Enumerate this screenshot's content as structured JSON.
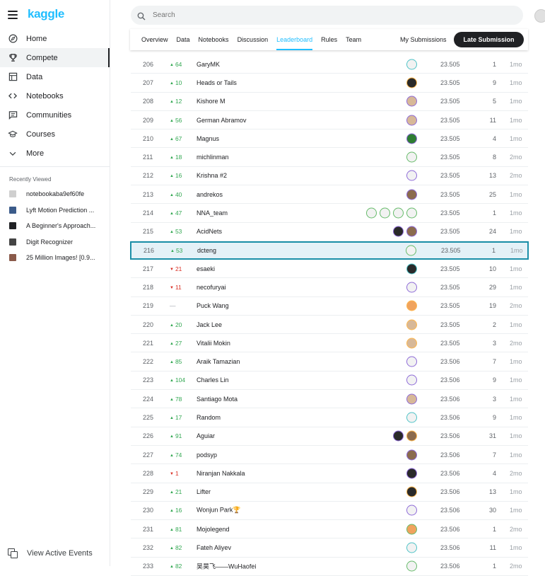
{
  "app": {
    "logo": "kaggle"
  },
  "sidebar": {
    "items": [
      {
        "label": "Home",
        "icon": "compass-icon",
        "active": false
      },
      {
        "label": "Compete",
        "icon": "trophy-icon",
        "active": true
      },
      {
        "label": "Data",
        "icon": "table-icon",
        "active": false
      },
      {
        "label": "Notebooks",
        "icon": "code-icon",
        "active": false
      },
      {
        "label": "Communities",
        "icon": "chat-icon",
        "active": false
      },
      {
        "label": "Courses",
        "icon": "mortarboard-icon",
        "active": false
      },
      {
        "label": "More",
        "icon": "chevron-down-icon",
        "active": false
      }
    ],
    "recent_title": "Recently Viewed",
    "recent": [
      {
        "label": "notebookaba9ef60fe",
        "color": "#cfcfcf"
      },
      {
        "label": "Lyft Motion Prediction ...",
        "color": "#3b5b8a"
      },
      {
        "label": "A Beginner's Approach...",
        "color": "#202124"
      },
      {
        "label": "Digit Recognizer",
        "color": "#444444"
      },
      {
        "label": "25 Million Images! [0.9...",
        "color": "#8a5a4a"
      }
    ],
    "active_events": "View Active Events"
  },
  "search": {
    "placeholder": "Search"
  },
  "tabs": [
    "Overview",
    "Data",
    "Notebooks",
    "Discussion",
    "Leaderboard",
    "Rules",
    "Team"
  ],
  "active_tab": "Leaderboard",
  "my_submissions": "My Submissions",
  "late_submission": "Late Submission",
  "colors": {
    "accent": "#20beff",
    "up": "#34a853",
    "down": "#d93025",
    "highlight_border": "#1b8fa8"
  },
  "leaderboard": [
    {
      "rank": "206",
      "delta": "64",
      "dir": "up",
      "team": "GaryMK",
      "score": "23.505",
      "entries": "1",
      "last": "1mo",
      "members": [
        [
          "white",
          "ring-teal"
        ]
      ]
    },
    {
      "rank": "207",
      "delta": "10",
      "dir": "up",
      "team": "Heads or Tails",
      "score": "23.505",
      "entries": "9",
      "last": "1mo",
      "members": [
        [
          "dark",
          "ring-orange"
        ]
      ]
    },
    {
      "rank": "208",
      "delta": "12",
      "dir": "up",
      "team": "Kishore M",
      "score": "23.505",
      "entries": "5",
      "last": "1mo",
      "members": [
        [
          "face",
          "ring-purple"
        ]
      ]
    },
    {
      "rank": "209",
      "delta": "56",
      "dir": "up",
      "team": "German Abramov",
      "score": "23.505",
      "entries": "11",
      "last": "1mo",
      "members": [
        [
          "face",
          "ring-purple"
        ]
      ]
    },
    {
      "rank": "210",
      "delta": "67",
      "dir": "up",
      "team": "Magnus",
      "score": "23.505",
      "entries": "4",
      "last": "1mo",
      "members": [
        [
          "green",
          "ring-purple"
        ]
      ]
    },
    {
      "rank": "211",
      "delta": "18",
      "dir": "up",
      "team": "michlinman",
      "score": "23.505",
      "entries": "8",
      "last": "2mo",
      "members": [
        [
          "white",
          "ring-green"
        ]
      ]
    },
    {
      "rank": "212",
      "delta": "16",
      "dir": "up",
      "team": "Krishna #2",
      "score": "23.505",
      "entries": "13",
      "last": "2mo",
      "members": [
        [
          "white",
          "ring-purple"
        ]
      ]
    },
    {
      "rank": "213",
      "delta": "40",
      "dir": "up",
      "team": "andrekos",
      "score": "23.505",
      "entries": "25",
      "last": "1mo",
      "members": [
        [
          "brown",
          "ring-purple"
        ]
      ]
    },
    {
      "rank": "214",
      "delta": "47",
      "dir": "up",
      "team": "NNA_team",
      "score": "23.505",
      "entries": "1",
      "last": "1mo",
      "members": [
        [
          "white",
          "ring-green"
        ],
        [
          "white",
          "ring-green"
        ],
        [
          "white",
          "ring-green"
        ],
        [
          "white",
          "ring-green"
        ]
      ]
    },
    {
      "rank": "215",
      "delta": "53",
      "dir": "up",
      "team": "AcidNets",
      "score": "23.505",
      "entries": "24",
      "last": "1mo",
      "members": [
        [
          "dark",
          "ring-purple"
        ],
        [
          "brown",
          "ring-purple"
        ]
      ]
    },
    {
      "rank": "216",
      "delta": "53",
      "dir": "up",
      "team": "dcteng",
      "score": "23.505",
      "entries": "1",
      "last": "1mo",
      "members": [
        [
          "white",
          "ring-green"
        ]
      ],
      "highlight": true
    },
    {
      "rank": "217",
      "delta": "21",
      "dir": "down",
      "team": "esaeki",
      "score": "23.505",
      "entries": "10",
      "last": "1mo",
      "members": [
        [
          "dark",
          "ring-teal"
        ]
      ]
    },
    {
      "rank": "218",
      "delta": "11",
      "dir": "down",
      "team": "necofuryai",
      "score": "23.505",
      "entries": "29",
      "last": "1mo",
      "members": [
        [
          "white",
          "ring-purple"
        ]
      ]
    },
    {
      "rank": "219",
      "delta": "—",
      "dir": "same",
      "team": "Puck Wang",
      "score": "23.505",
      "entries": "19",
      "last": "2mo",
      "members": [
        [
          "orange",
          "ring-orange"
        ]
      ]
    },
    {
      "rank": "220",
      "delta": "20",
      "dir": "up",
      "team": "Jack Lee",
      "score": "23.505",
      "entries": "2",
      "last": "1mo",
      "members": [
        [
          "face",
          "ring-orange"
        ]
      ]
    },
    {
      "rank": "221",
      "delta": "27",
      "dir": "up",
      "team": "Vitalii Mokin",
      "score": "23.505",
      "entries": "3",
      "last": "2mo",
      "members": [
        [
          "face",
          "ring-orange"
        ]
      ]
    },
    {
      "rank": "222",
      "delta": "85",
      "dir": "up",
      "team": "Araik Tamazian",
      "score": "23.506",
      "entries": "7",
      "last": "1mo",
      "members": [
        [
          "white",
          "ring-purple"
        ]
      ]
    },
    {
      "rank": "223",
      "delta": "104",
      "dir": "up",
      "team": "Charles Lin",
      "score": "23.506",
      "entries": "9",
      "last": "1mo",
      "members": [
        [
          "white",
          "ring-purple"
        ]
      ]
    },
    {
      "rank": "224",
      "delta": "78",
      "dir": "up",
      "team": "Santiago Mota",
      "score": "23.506",
      "entries": "3",
      "last": "1mo",
      "members": [
        [
          "face",
          "ring-purple"
        ]
      ]
    },
    {
      "rank": "225",
      "delta": "17",
      "dir": "up",
      "team": "Random",
      "score": "23.506",
      "entries": "9",
      "last": "1mo",
      "members": [
        [
          "white",
          "ring-teal"
        ]
      ]
    },
    {
      "rank": "226",
      "delta": "91",
      "dir": "up",
      "team": "Aguiar",
      "score": "23.506",
      "entries": "31",
      "last": "1mo",
      "members": [
        [
          "dark",
          "ring-purple"
        ],
        [
          "brown",
          "ring-orange"
        ]
      ]
    },
    {
      "rank": "227",
      "delta": "74",
      "dir": "up",
      "team": "podsyp",
      "score": "23.506",
      "entries": "7",
      "last": "1mo",
      "members": [
        [
          "brown",
          "ring-purple"
        ]
      ]
    },
    {
      "rank": "228",
      "delta": "1",
      "dir": "down",
      "team": "Niranjan Nakkala",
      "score": "23.506",
      "entries": "4",
      "last": "2mo",
      "members": [
        [
          "dark",
          "ring-purple"
        ]
      ]
    },
    {
      "rank": "229",
      "delta": "21",
      "dir": "up",
      "team": "Lifter",
      "score": "23.506",
      "entries": "13",
      "last": "1mo",
      "members": [
        [
          "dark",
          "ring-orange"
        ]
      ]
    },
    {
      "rank": "230",
      "delta": "16",
      "dir": "up",
      "team": "Wonjun Park🏆",
      "score": "23.506",
      "entries": "30",
      "last": "1mo",
      "members": [
        [
          "white",
          "ring-purple"
        ]
      ]
    },
    {
      "rank": "231",
      "delta": "81",
      "dir": "up",
      "team": "Mojolegend",
      "score": "23.506",
      "entries": "1",
      "last": "2mo",
      "members": [
        [
          "orange",
          "ring-green"
        ]
      ]
    },
    {
      "rank": "232",
      "delta": "82",
      "dir": "up",
      "team": "Fateh Aliyev",
      "score": "23.506",
      "entries": "11",
      "last": "1mo",
      "members": [
        [
          "white",
          "ring-teal"
        ]
      ]
    },
    {
      "rank": "233",
      "delta": "82",
      "dir": "up",
      "team": "吴昊飞——WuHaofei",
      "score": "23.506",
      "entries": "1",
      "last": "2mo",
      "members": [
        [
          "white",
          "ring-green"
        ]
      ]
    }
  ]
}
